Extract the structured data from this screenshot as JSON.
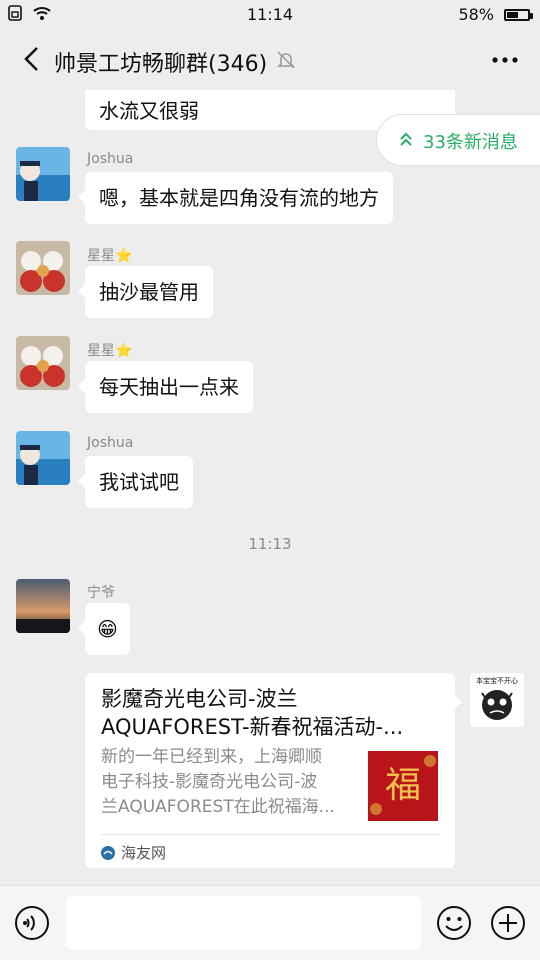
{
  "status": {
    "time": "11:14",
    "battery": "58%",
    "battery_level": 0.58
  },
  "header": {
    "title": "帅景工坊畅聊群(346)"
  },
  "new_messages": {
    "label": "33条新消息"
  },
  "messages": [
    {
      "text": "水流又很弱"
    },
    {
      "sender": "Joshua",
      "text": "嗯，基本就是四角没有流的地方"
    },
    {
      "sender": "星星⭐",
      "text": "抽沙最管用"
    },
    {
      "sender": "星星⭐",
      "text": "每天抽出一点来"
    },
    {
      "sender": "Joshua",
      "text": "我试试吧"
    }
  ],
  "timestamp": "11:13",
  "ning": {
    "sender": "宁爷",
    "emoji": "😁"
  },
  "card": {
    "title_line1": "影魔奇光电公司-波兰",
    "title_line2": "AQUAFOREST-新春祝福活动-...",
    "desc_line1": "新的一年已经到来，上海卿顺",
    "desc_line2": "电子科技-影魔奇光电公司-波",
    "desc_line3": "兰AQUAFOREST在此祝福海...",
    "thumb_char": "福",
    "source": "海友网"
  },
  "sticker_text": "本宝宝不开心",
  "input": {
    "placeholder": ""
  },
  "colors": {
    "accent": "#2aae67",
    "background": "#ededed"
  }
}
